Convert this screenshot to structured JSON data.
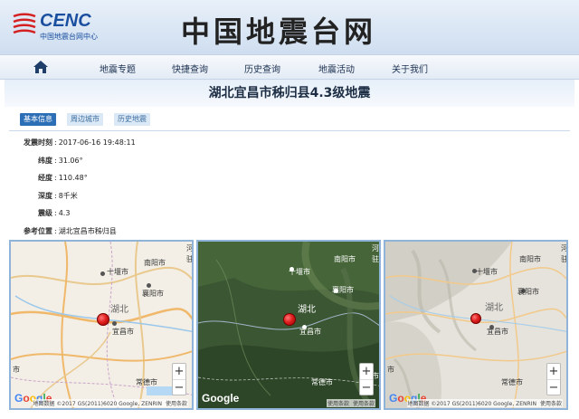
{
  "header": {
    "logo_text": "CENC",
    "logo_subtitle": "中国地震台网中心",
    "site_title": "中国地震台网"
  },
  "nav": {
    "home_icon": "home-icon",
    "items": [
      "地震专题",
      "快捷查询",
      "历史查询",
      "地震活动",
      "关于我们"
    ]
  },
  "event": {
    "title": "湖北宜昌市秭归县4.3级地震"
  },
  "tabs": [
    "基本信息",
    "周边城市",
    "历史地震"
  ],
  "info": {
    "time_label": "发震时刻",
    "time_value": "2017-06-16 19:48:11",
    "lat_label": "纬度",
    "lat_value": "31.06°",
    "lon_label": "经度",
    "lon_value": "110.48°",
    "depth_label": "深度",
    "depth_value": "8千米",
    "mag_label": "震级",
    "mag_value": "4.3",
    "ref_label": "参考位置",
    "ref_value": "湖北宜昌市秭归县"
  },
  "maps": {
    "cities": {
      "nanyang": "南阳市",
      "shiyan": "十堰市",
      "xiangyang": "襄阳市",
      "hubei": "湖北",
      "yichang": "宜昌市",
      "changde": "常德市",
      "he": "河",
      "zhu": "驻",
      "shi": "市"
    },
    "zoom_in": "+",
    "zoom_out": "−",
    "google": "Google",
    "attribution": "地图数据 ©2017 GS(2011)6020 Google, ZENRIN",
    "terms": "使用条款"
  },
  "colors": {
    "accent": "#2d6fb7",
    "marker": "#e02020"
  }
}
